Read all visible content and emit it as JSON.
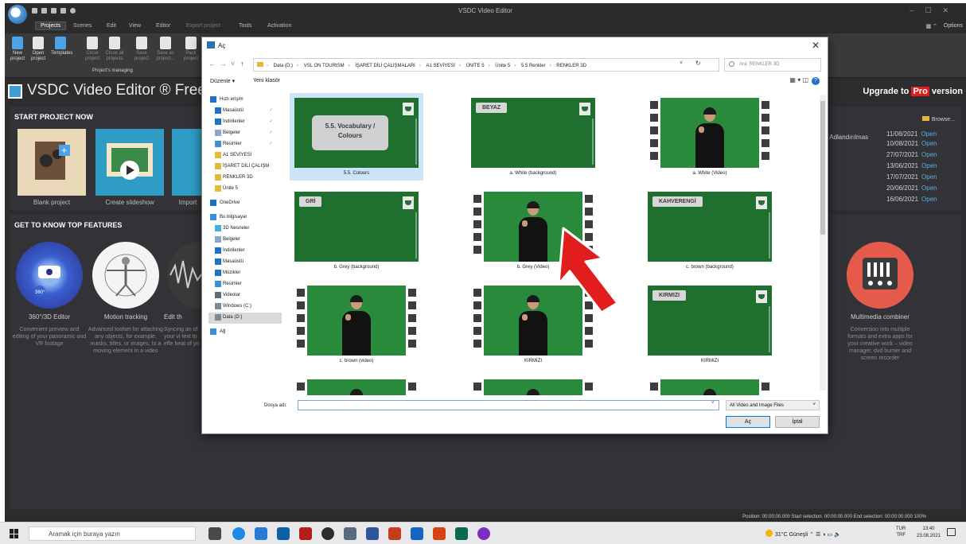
{
  "app": {
    "title": "VSDC Video Editor",
    "menu": [
      "Projects",
      "Scenes",
      "Edit",
      "View",
      "Editor",
      "Export project",
      "Tools",
      "Activation"
    ],
    "options_label": "Options",
    "ribbon": {
      "buttons": [
        "New project",
        "Open project",
        "Templates",
        "Close project",
        "Close all projects",
        "Save project",
        "Save as project...",
        "Pack project"
      ],
      "group_label": "Project's managing"
    },
    "brand": "VSDC Video Editor ® Free Ed",
    "upgrade": {
      "prefix": "Upgrade to ",
      "pro": "Pro",
      "suffix": " version"
    },
    "start_project": {
      "heading": "START PROJECT NOW",
      "tiles": [
        "Blank project",
        "Create slideshow",
        "Import"
      ],
      "browse": "Browse...",
      "recent_name": "n Adlandırılmas",
      "recent": [
        {
          "date": "11/08/2021",
          "action": "Open"
        },
        {
          "date": "10/08/2021",
          "action": "Open"
        },
        {
          "date": "27/07/2021",
          "action": "Open"
        },
        {
          "date": "13/06/2021",
          "action": "Open"
        },
        {
          "date": "17/07/2021",
          "action": "Open"
        },
        {
          "date": "20/06/2021",
          "action": "Open"
        },
        {
          "date": "16/06/2021",
          "action": "Open"
        }
      ]
    },
    "features": {
      "heading": "GET TO KNOW TOP FEATURES",
      "items": [
        {
          "title": "360°/3D Editor",
          "desc": "Convenient preview and editing of your panoramic and VR footage",
          "badge": "360°"
        },
        {
          "title": "Motion tracking",
          "desc": "Advanced toolset for attaching any objects, for example, masks, titles, or images, to a moving element in a video"
        },
        {
          "title": "Edit th",
          "desc": "Syncing an of your vi text to effe beat of yo"
        },
        {
          "title": "Multimedia combiner",
          "desc": "Conversion into multiple formats and extra apps for your creative work – video manager, dvd burner and screen recorder"
        }
      ]
    },
    "status": "Position: 00:00:00.000   Start selection: 00:00:00.000   End selection: 00:00:00.000        100%"
  },
  "dialog": {
    "title": "Aç",
    "close": "✕",
    "breadcrumb": [
      "Data (D:)",
      "VSL ON TOURISM",
      "İŞARET DİLİ ÇALIŞMALARI",
      "A1 SEVİYESİ",
      "ÜNİTE 5",
      "Ünite 5",
      "5.5 Renkler",
      "RENKLER 3D"
    ],
    "search_placeholder": "Ara: RENKLER 3D",
    "commands": [
      "Düzenle ▾",
      "Yeni klasör"
    ],
    "nav": [
      {
        "label": "Hızlı erişim",
        "pin": false,
        "icon": "star-icon"
      },
      {
        "label": "Masaüstü",
        "pin": true,
        "icon": "desktop-icon"
      },
      {
        "label": "İndirilenler",
        "pin": true,
        "icon": "download-icon"
      },
      {
        "label": "Belgeler",
        "pin": true,
        "icon": "documents-icon"
      },
      {
        "label": "Resimler",
        "pin": true,
        "icon": "pictures-icon"
      },
      {
        "label": "A1 SEVİYESİ",
        "pin": false,
        "icon": "folder-icon"
      },
      {
        "label": "İŞARET DİLİ ÇALIŞM",
        "pin": false,
        "icon": "folder-icon"
      },
      {
        "label": "RENKLER 3D",
        "pin": false,
        "icon": "folder-icon"
      },
      {
        "label": "Ünite 5",
        "pin": false,
        "icon": "folder-icon"
      },
      {
        "label": "OneDrive",
        "pin": false,
        "icon": "cloud-icon"
      },
      {
        "label": "Bu bilgisayar",
        "pin": false,
        "icon": "computer-icon"
      },
      {
        "label": "3D Nesneler",
        "pin": false,
        "icon": "cube-icon"
      },
      {
        "label": "Belgeler",
        "pin": false,
        "icon": "documents-icon"
      },
      {
        "label": "İndirilenler",
        "pin": false,
        "icon": "download-icon"
      },
      {
        "label": "Masaüstü",
        "pin": false,
        "icon": "desktop-icon"
      },
      {
        "label": "Müzikler",
        "pin": false,
        "icon": "music-icon"
      },
      {
        "label": "Resimler",
        "pin": false,
        "icon": "pictures-icon"
      },
      {
        "label": "Videolar",
        "pin": false,
        "icon": "video-icon"
      },
      {
        "label": "Windows (C:)",
        "pin": false,
        "icon": "drive-icon"
      },
      {
        "label": "Data (D:)",
        "pin": false,
        "icon": "drive-icon",
        "selected": true
      },
      {
        "label": "Ağ",
        "pin": false,
        "icon": "network-icon"
      }
    ],
    "files": [
      {
        "caption": "5.5. Colours",
        "kind": "title",
        "text1": "5.5. Vocabulary /",
        "text2": "Colours",
        "selected": true
      },
      {
        "caption": "a. White (background)",
        "kind": "chip",
        "text1": "BEYAZ"
      },
      {
        "caption": "a. White (Video)",
        "kind": "video"
      },
      {
        "caption": "b. Grey (background)",
        "kind": "chip",
        "text1": "GRİ"
      },
      {
        "caption": "b. Grey (Video)",
        "kind": "video"
      },
      {
        "caption": "c. brown (background)",
        "kind": "chip",
        "text1": "KAHVERENGİ"
      },
      {
        "caption": "c. brown (video)",
        "kind": "video"
      },
      {
        "caption": "KIRMIZI",
        "kind": "video"
      },
      {
        "caption": "KIRMIZI",
        "kind": "chip",
        "text1": "KIRMIZI"
      },
      {
        "caption": "",
        "kind": "video"
      },
      {
        "caption": "",
        "kind": "video"
      },
      {
        "caption": "",
        "kind": "video"
      }
    ],
    "filename_label": "Dosya adı:",
    "filename_value": "",
    "filter": "All Video and Image Files",
    "open_button": "Aç",
    "cancel_button": "İptal"
  },
  "taskbar": {
    "search_placeholder": "Aramak için buraya yazın",
    "weather": "31°C  Güneşli",
    "language": [
      "TUR",
      "TRF"
    ],
    "time": "13:40",
    "date": "23.08.2021"
  },
  "colors": {
    "app_bg": "#2d2d30",
    "accent_blue": "#0078d7",
    "arrow_red": "#e21d1d",
    "thumb_green": "#1f6f2e"
  }
}
